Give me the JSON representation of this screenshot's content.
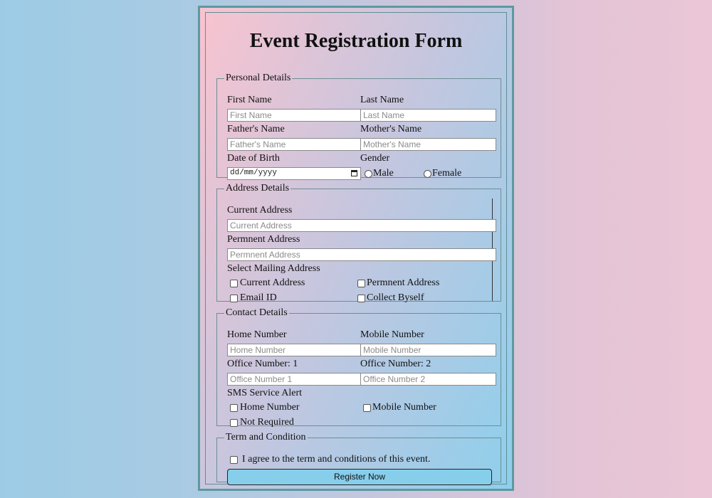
{
  "title": "Event Registration Form",
  "personal": {
    "legend": "Personal Details",
    "first_name_label": "First Name",
    "first_name_placeholder": "First Name",
    "last_name_label": "Last Name",
    "last_name_placeholder": "Last Name",
    "father_label": "Father's Name",
    "father_placeholder": "Father's Name",
    "mother_label": "Mother's Name",
    "mother_placeholder": "Mother's Name",
    "dob_label": "Date of Birth",
    "dob_value": "dd/mm/yyyy",
    "gender_label": "Gender",
    "gender_options": [
      "Male",
      "Female"
    ]
  },
  "address": {
    "legend": "Address Details",
    "current_label": "Current Address",
    "current_placeholder": "Current Address",
    "permanent_label": "Permnent Address",
    "permanent_placeholder": "Permnent Address",
    "mailing_label": "Select Mailing Address",
    "mailing_options": [
      "Current Address",
      "Permnent Address",
      "Email ID",
      "Collect Byself"
    ]
  },
  "contact": {
    "legend": "Contact Details",
    "home_label": "Home Number",
    "home_placeholder": "Home Number",
    "mobile_label": "Mobile Number",
    "mobile_placeholder": "Mobile Number",
    "office1_label": "Office Number: 1",
    "office1_placeholder": "Office Number 1",
    "office2_label": "Office Number: 2",
    "office2_placeholder": "Office Number 2",
    "sms_label": "SMS Service Alert",
    "sms_options": [
      "Home Number",
      "Mobile Number",
      "Not Required"
    ]
  },
  "terms": {
    "legend": "Term and Condition",
    "agree_label": "I agree to the term and conditions of this event.",
    "submit_label": "Register Now"
  },
  "colors": {
    "button_bg": "#87ceeb",
    "border": "#5b9aa0"
  }
}
